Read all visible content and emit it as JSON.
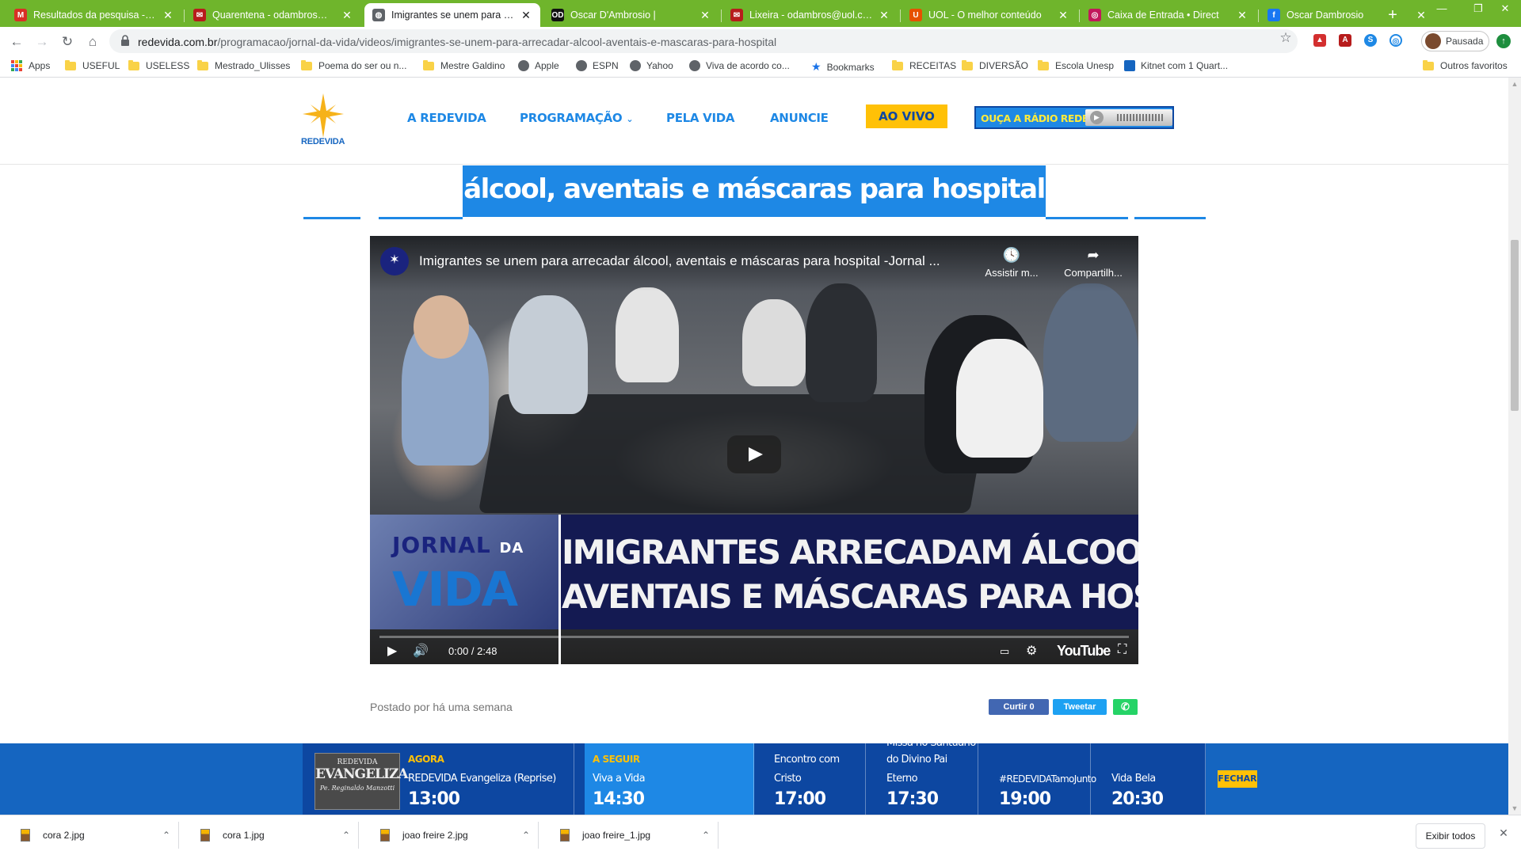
{
  "browser": {
    "tabs": [
      {
        "title": "Resultados da pesquisa - os",
        "icon": "gmail-icon",
        "color": "#d93025",
        "glyph": "M",
        "active": false
      },
      {
        "title": "Quarentena - odambros@uo",
        "icon": "uol-mail-icon",
        "color": "#b71c1c",
        "glyph": "✉",
        "active": false
      },
      {
        "title": "Imigrantes se unem para arr",
        "icon": "globe-icon",
        "color": "#5f6368",
        "glyph": "◍",
        "active": true
      },
      {
        "title": "Oscar D'Ambrosio |",
        "icon": "od-icon",
        "color": "#111111",
        "glyph": "OD",
        "active": false
      },
      {
        "title": "Lixeira - odambros@uol.com",
        "icon": "uol-mail-icon",
        "color": "#b71c1c",
        "glyph": "✉",
        "active": false
      },
      {
        "title": "UOL - O melhor conteúdo",
        "icon": "uol-icon",
        "color": "#e65100",
        "glyph": "U",
        "active": false
      },
      {
        "title": "Caixa de Entrada • Direct",
        "icon": "instagram-icon",
        "color": "#c2185b",
        "glyph": "◎",
        "active": false
      },
      {
        "title": "Oscar Dambrosio",
        "icon": "facebook-icon",
        "color": "#1877f2",
        "glyph": "f",
        "active": false
      }
    ],
    "url_host": "redevida.com.br",
    "url_path": "/programacao/jornal-da-vida/videos/imigrantes-se-unem-para-arrecadar-alcool-aventais-e-mascaras-para-hospital",
    "profile_label": "Pausada",
    "bookmarks": [
      {
        "label": "Apps",
        "type": "apps"
      },
      {
        "label": "USEFUL",
        "type": "folder"
      },
      {
        "label": "USELESS",
        "type": "folder"
      },
      {
        "label": "Mestrado_Ulisses",
        "type": "folder"
      },
      {
        "label": "Poema do ser ou n...",
        "type": "folder"
      },
      {
        "label": "Mestre Galdino",
        "type": "folder"
      },
      {
        "label": "Apple",
        "type": "globe"
      },
      {
        "label": "ESPN",
        "type": "globe"
      },
      {
        "label": "Yahoo",
        "type": "globe"
      },
      {
        "label": "Viva de acordo co...",
        "type": "globe"
      },
      {
        "label": "Bookmarks",
        "type": "star"
      },
      {
        "label": "RECEITAS",
        "type": "folder"
      },
      {
        "label": "DIVERSÃO",
        "type": "folder"
      },
      {
        "label": "Escola Unesp",
        "type": "folder"
      },
      {
        "label": "Kitnet com 1 Quart...",
        "type": "site"
      }
    ],
    "other_bookmarks": "Outros favoritos"
  },
  "site": {
    "logo_text": "REDEVIDA",
    "nav": {
      "a_redevida": "A REDEVIDA",
      "programacao": "PROGRAMAÇÃO",
      "pela_vida": "PELA VIDA",
      "anuncie": "ANUNCIE",
      "ao_vivo": "AO VIVO",
      "radio": "OUÇA A RÁDIO REDEVIDA"
    },
    "article_title_visible": "álcool, aventais e máscaras para hospital"
  },
  "video": {
    "title": "Imigrantes se unem para arrecadar álcool, aventais e máscaras para hospital -Jornal ...",
    "watch_later": "Assistir m...",
    "share": "Compartilh...",
    "program_line1": "JORNAL",
    "program_line1b": "DA",
    "program_line2": "VIDA",
    "headline_line1": "IMIGRANTES ARRECADAM ÁLCOOL,",
    "headline_line2": "AVENTAIS E MÁSCARAS PARA HOSPITAL",
    "time": "0:00 / 2:48",
    "youtube": "YouTube",
    "progress": 0
  },
  "post": {
    "posted": "Postado por há uma semana",
    "like": "Curtir 0",
    "tweet": "Tweetar"
  },
  "schedule": {
    "thumb_line1": "REDEVIDA",
    "thumb_line2": "EVANGELIZA",
    "thumb_line3": "Pe. Reginaldo Manzotti",
    "now_tag": "AGORA",
    "now_prog": "REDEVIDA Evangeliza (Reprise)",
    "now_time": "13:00",
    "next_tag": "A SEGUIR",
    "next_prog": "Viva a Vida",
    "next_time": "14:30",
    "s3_prog_a": "Encontro com",
    "s3_prog_b": "Cristo",
    "s3_time": "17:00",
    "s4_prog_a": "Missa no Santuário",
    "s4_prog_b": "do Divino Pai",
    "s4_prog_c": "Eterno",
    "s4_time": "17:30",
    "s5_prog": "#REDEVIDATamoJunto",
    "s5_time": "19:00",
    "s6_prog": "Vida Bela",
    "s6_time": "20:30",
    "close": "FECHAR"
  },
  "downloads": {
    "files": [
      "cora 2.jpg",
      "cora 1.jpg",
      "joao freire 2.jpg",
      "joao freire_1.jpg"
    ],
    "show_all": "Exibir todos"
  },
  "colors": {
    "chrome_green": "#6fb52c",
    "brand_blue": "#1e88e5",
    "brand_dark": "#0d47a1",
    "live_yellow": "#ffc107"
  }
}
